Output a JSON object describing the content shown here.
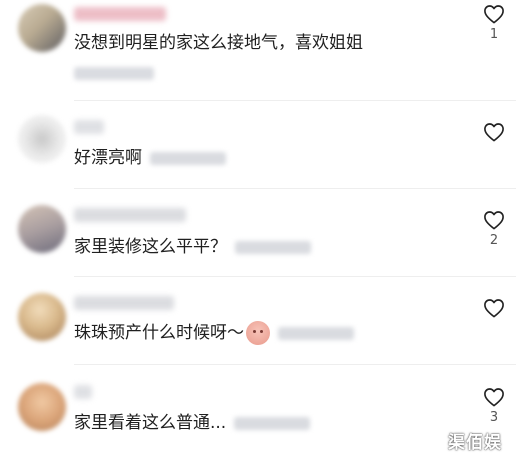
{
  "comments": [
    {
      "text": "没想到明星的家这么接地气，喜欢姐姐",
      "likes": "1",
      "avatar_colors": [
        "#cdbfa6",
        "#6b6a6d"
      ],
      "username_color": "#e7a8b4"
    },
    {
      "text": "好漂亮啊",
      "likes": "",
      "avatar_colors": [
        "#e8e8e8",
        "#bdbdbd"
      ],
      "username_color": "#d4d6db"
    },
    {
      "text": "家里装修这么平平？",
      "likes": "2",
      "avatar_colors": [
        "#c9b7a9",
        "#7f7d8b"
      ],
      "username_color": "#cfd1d6"
    },
    {
      "text": "珠珠预产什么时候呀～",
      "likes": "",
      "avatar_colors": [
        "#e3c9a3",
        "#a57c54"
      ],
      "username_color": "#cfd1d6"
    },
    {
      "text": "家里看着这么普通...",
      "likes": "3",
      "avatar_colors": [
        "#e6b893",
        "#b07f56"
      ],
      "username_color": "#d4d6db"
    }
  ],
  "watermark": "渠佰娱",
  "icons": {
    "like": "heart-outline-icon"
  }
}
